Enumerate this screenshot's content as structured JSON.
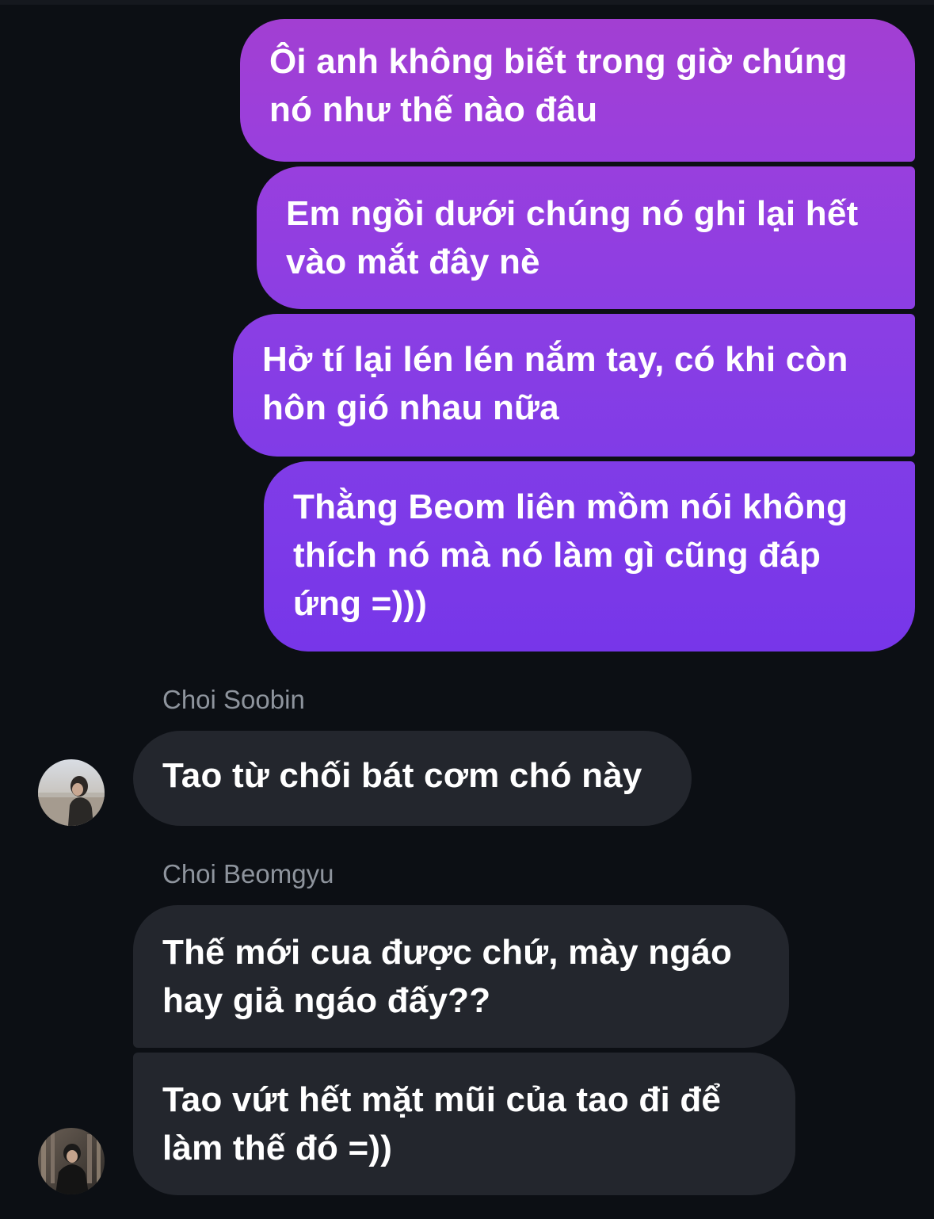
{
  "thread": {
    "outgoing": [
      {
        "text": "Ôi anh không biết trong giờ chúng\nnó như thế nào đâu"
      },
      {
        "text": "Em ngồi dưới chúng nó ghi lại hết\nvào mắt đây nè"
      },
      {
        "text": "Hở tí lại lén lén nắm tay, có khi còn\nhôn gió nhau nữa"
      },
      {
        "text": "Thằng Beom liên mồm nói không\nthích nó mà nó làm gì cũng đáp\nứng =)))"
      }
    ],
    "incoming": [
      {
        "sender": "Choi Soobin",
        "avatar_icon": "user-avatar-photo",
        "messages": [
          {
            "text": "Tao từ chối bát cơm chó này"
          }
        ]
      },
      {
        "sender": "Choi Beomgyu",
        "avatar_icon": "user-avatar-photo",
        "messages": [
          {
            "text": "Thế mới cua được chứ, mày ngáo\nhay giả ngáo đấy??"
          },
          {
            "text": "Tao vứt hết mặt mũi của tao đi để\nlàm thế đó =))"
          }
        ]
      }
    ]
  },
  "colors": {
    "background": "#0c0f14",
    "outgoing_top": "#a23fd2",
    "outgoing_bottom": "#7736e9",
    "incoming_bubble": "#23262d",
    "sender_name": "#8e949d",
    "message_text": "#ffffff"
  }
}
